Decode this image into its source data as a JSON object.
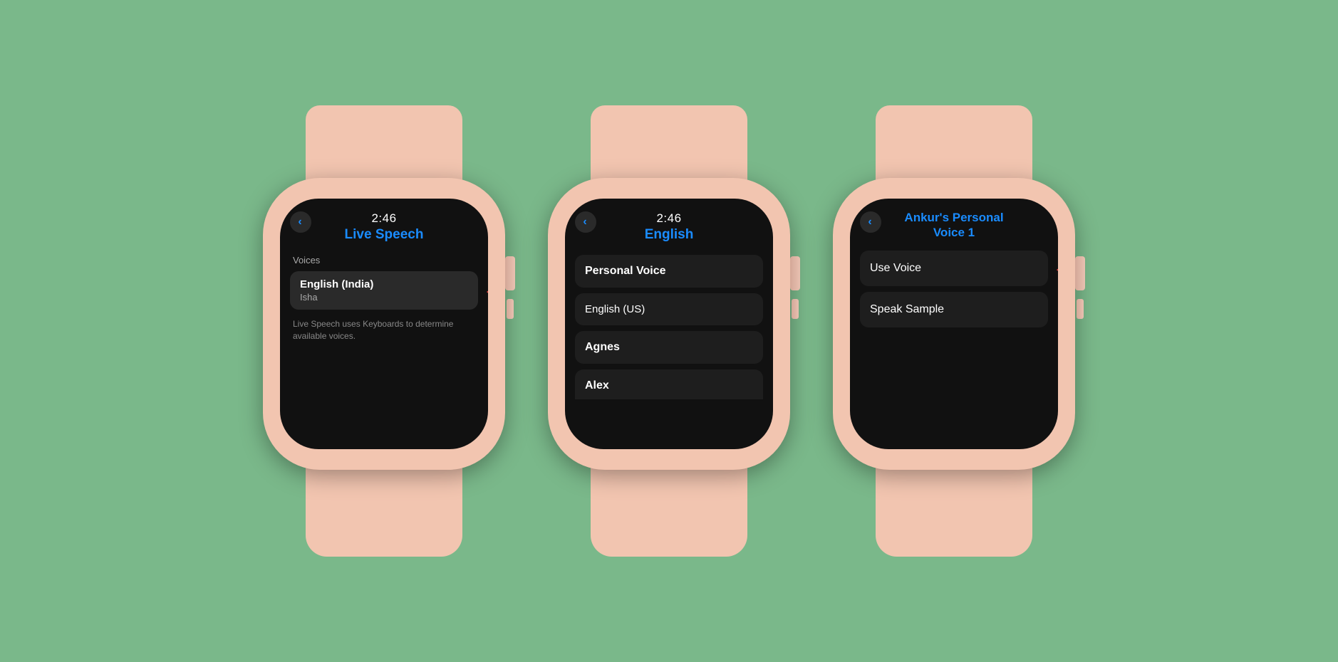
{
  "background": "#7ab88a",
  "watches": [
    {
      "id": "watch1",
      "screen": {
        "time": "2:46",
        "title": "Live Speech",
        "has_back": true,
        "content_type": "live_speech",
        "voices_label": "Voices",
        "selected_voice": {
          "title": "English (India)",
          "subtitle": "Isha"
        },
        "note": "Live Speech uses Keyboards to determine available voices.",
        "has_red_arrow": true
      }
    },
    {
      "id": "watch2",
      "screen": {
        "time": "2:46",
        "title": "English",
        "has_back": true,
        "content_type": "english_list",
        "items": [
          {
            "text": "Personal Voice",
            "bold": true,
            "sub": null
          },
          {
            "text": "English (US)",
            "bold": false,
            "sub": null
          },
          {
            "text": "Agnes",
            "bold": true,
            "sub": null
          },
          {
            "text": "Alex",
            "bold": true,
            "sub": null,
            "partial": true
          }
        ]
      }
    },
    {
      "id": "watch3",
      "screen": {
        "time": "",
        "title": "Ankur's Personal\nVoice 1",
        "has_back": true,
        "content_type": "voice_options",
        "items": [
          {
            "text": "Use Voice",
            "has_red_arrow": true
          },
          {
            "text": "Speak Sample",
            "has_red_arrow": false
          }
        ]
      }
    }
  ],
  "labels": {
    "back": "‹",
    "red_arrow": "←"
  }
}
